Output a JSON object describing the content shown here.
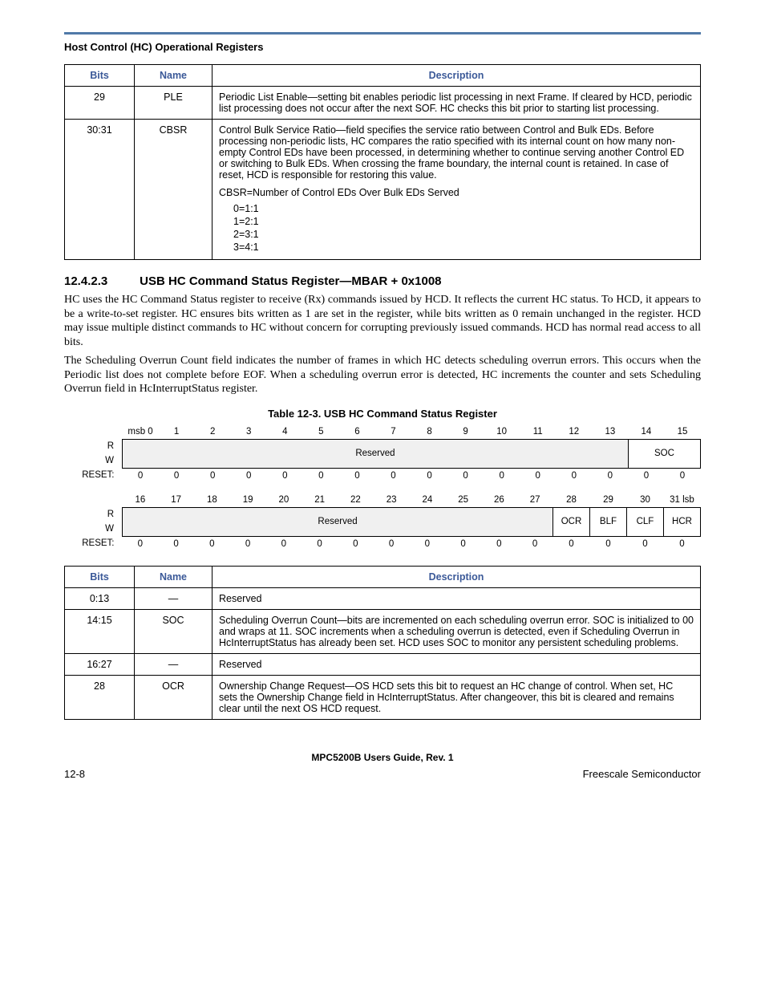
{
  "header": {
    "section_label": "Host Control (HC) Operational Registers"
  },
  "table1": {
    "headers": {
      "bits": "Bits",
      "name": "Name",
      "desc": "Description"
    },
    "rows": [
      {
        "bits": "29",
        "name": "PLE",
        "desc": "Periodic List Enable—setting bit enables periodic list processing in next Frame. If cleared by HCD, periodic list processing does not occur after the next SOF. HC checks this bit prior to starting list processing."
      },
      {
        "bits": "30:31",
        "name": "CBSR",
        "desc": "Control Bulk Service Ratio—field specifies the service ratio between Control and Bulk EDs. Before processing non-periodic lists, HC compares the ratio specified with its internal count on how many non-empty Control EDs have been processed, in determining whether to continue serving another Control ED or switching to Bulk EDs. When crossing the frame boundary, the internal count is retained. In case of reset, HCD is responsible for restoring this value.",
        "extra": "CBSR=Number of Control EDs Over Bulk EDs Served",
        "list": [
          "0=1:1",
          "1=2:1",
          "2=3:1",
          "3=4:1"
        ]
      }
    ]
  },
  "heading": {
    "num": "12.4.2.3",
    "title": "USB HC Command Status Register—MBAR + 0x1008"
  },
  "paragraphs": [
    "HC uses the HC Command Status register to receive (Rx) commands issued by HCD. It reflects the current HC status. To HCD, it appears to be a write-to-set register. HC ensures bits written as 1 are set in the register, while bits written as 0 remain unchanged in the register. HCD may issue multiple distinct commands to HC without concern for corrupting previously issued commands. HCD has normal read access to all bits.",
    "The Scheduling Overrun Count field indicates the number of frames in which HC detects scheduling overrun errors. This occurs when the Periodic list does not complete before EOF. When a scheduling overrun error is detected, HC increments the counter and sets Scheduling Overrun field in HcInterruptStatus register."
  ],
  "table_caption": "Table 12-3. USB HC Command Status Register",
  "bitfield1": {
    "bitnums": [
      "msb 0",
      "1",
      "2",
      "3",
      "4",
      "5",
      "6",
      "7",
      "8",
      "9",
      "10",
      "11",
      "12",
      "13",
      "14",
      "15"
    ],
    "r_label": "R",
    "w_label": "W",
    "reset_label": "RESET:",
    "reserved": "Reserved",
    "soc": "SOC",
    "resets": [
      "0",
      "0",
      "0",
      "0",
      "0",
      "0",
      "0",
      "0",
      "0",
      "0",
      "0",
      "0",
      "0",
      "0",
      "0",
      "0"
    ]
  },
  "bitfield2": {
    "bitnums": [
      "16",
      "17",
      "18",
      "19",
      "20",
      "21",
      "22",
      "23",
      "24",
      "25",
      "26",
      "27",
      "28",
      "29",
      "30",
      "31 lsb"
    ],
    "r_label": "R",
    "w_label": "W",
    "reset_label": "RESET:",
    "reserved": "Reserved",
    "ocr": "OCR",
    "blf": "BLF",
    "clf": "CLF",
    "hcr": "HCR",
    "resets": [
      "0",
      "0",
      "0",
      "0",
      "0",
      "0",
      "0",
      "0",
      "0",
      "0",
      "0",
      "0",
      "0",
      "0",
      "0",
      "0"
    ]
  },
  "table2": {
    "headers": {
      "bits": "Bits",
      "name": "Name",
      "desc": "Description"
    },
    "rows": [
      {
        "bits": "0:13",
        "name": "—",
        "desc": "Reserved"
      },
      {
        "bits": "14:15",
        "name": "SOC",
        "desc": "Scheduling Overrun Count—bits are incremented on each scheduling overrun error. SOC is initialized to 00 and wraps at 11. SOC increments when a scheduling overrun is detected, even if Scheduling Overrun in HcInterruptStatus has already been set. HCD uses SOC to monitor any persistent scheduling problems."
      },
      {
        "bits": "16:27",
        "name": "—",
        "desc": "Reserved"
      },
      {
        "bits": "28",
        "name": "OCR",
        "desc": "Ownership Change Request—OS HCD sets this bit to request an HC change of control. When set, HC sets the Ownership Change field in HcInterruptStatus. After changeover, this bit is cleared and remains clear until the next OS HCD request."
      }
    ]
  },
  "footer": {
    "center": "MPC5200B Users Guide, Rev. 1",
    "left": "12-8",
    "right": "Freescale Semiconductor"
  }
}
